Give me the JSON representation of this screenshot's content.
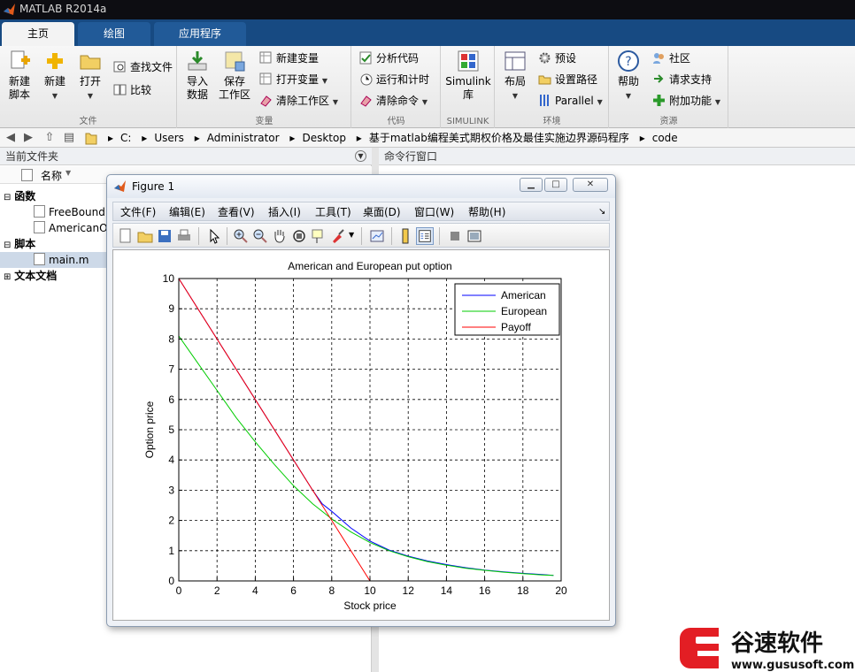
{
  "window": {
    "title": "MATLAB R2014a"
  },
  "tabs": [
    {
      "label": "主页"
    },
    {
      "label": "绘图"
    },
    {
      "label": "应用程序"
    }
  ],
  "ribbon": {
    "file": {
      "title": "文件",
      "new_script": "新建\n脚本",
      "new": "新建",
      "open": "打开",
      "find_files": "查找文件",
      "compare": "比较"
    },
    "variable": {
      "title": "变量",
      "import": "导入\n数据",
      "save_ws": "保存\n工作区",
      "new_var": "新建变量",
      "open_var": "打开变量",
      "clear_ws": "清除工作区"
    },
    "code": {
      "title": "代码",
      "analyze": "分析代码",
      "run_time": "运行和计时",
      "clear_cmd": "清除命令"
    },
    "simulink": {
      "title": "SIMULINK",
      "library": "Simulink\n库"
    },
    "env": {
      "title": "环境",
      "layout": "布局",
      "prefs": "预设",
      "set_path": "设置路径",
      "parallel": "Parallel"
    },
    "resources": {
      "title": "资源",
      "help": "帮助",
      "community": "社区",
      "support": "请求支持",
      "addons": "附加功能"
    }
  },
  "address": {
    "crumbs": [
      "C:",
      "Users",
      "Administrator",
      "Desktop",
      "基于matlab编程美式期权价格及最佳实施边界源码程序",
      "code"
    ]
  },
  "file_browser": {
    "title": "当前文件夹",
    "name_col": "名称",
    "rows": [
      {
        "label": "函数",
        "kind": "group"
      },
      {
        "label": "FreeBound",
        "kind": "file"
      },
      {
        "label": "AmericanO",
        "kind": "file"
      },
      {
        "label": "脚本",
        "kind": "group"
      },
      {
        "label": "main.m",
        "kind": "file"
      },
      {
        "label": "文本文档",
        "kind": "group"
      }
    ]
  },
  "command_window": {
    "title": "命令行窗口"
  },
  "figure": {
    "title": "Figure 1",
    "menus": [
      "文件(F)",
      "编辑(E)",
      "查看(V)",
      "插入(I)",
      "工具(T)",
      "桌面(D)",
      "窗口(W)",
      "帮助(H)"
    ]
  },
  "chart_data": {
    "type": "line",
    "title": "American and European put option",
    "xlabel": "Stock price",
    "ylabel": "Option price",
    "xlim": [
      0,
      20
    ],
    "ylim": [
      0,
      10
    ],
    "xticks": [
      0,
      2,
      4,
      6,
      8,
      10,
      12,
      14,
      16,
      18,
      20
    ],
    "yticks": [
      0,
      1,
      2,
      3,
      4,
      5,
      6,
      7,
      8,
      9,
      10
    ],
    "grid": true,
    "legend_position": "top-right",
    "series": [
      {
        "name": "American",
        "color": "#0000ff",
        "x": [
          0,
          2,
          4,
          6,
          7,
          7.5,
          8,
          9,
          10,
          11,
          12,
          13,
          14,
          15,
          16,
          17,
          18,
          19,
          19.6
        ],
        "y": [
          10,
          8,
          6,
          4,
          3,
          2.55,
          2.3,
          1.75,
          1.32,
          1.02,
          0.82,
          0.66,
          0.54,
          0.44,
          0.36,
          0.3,
          0.25,
          0.21,
          0.18
        ]
      },
      {
        "name": "European",
        "color": "#00cc00",
        "x": [
          0,
          1,
          2,
          3,
          4,
          5,
          6,
          7,
          8,
          9,
          10,
          11,
          12,
          13,
          14,
          15,
          16,
          17,
          18,
          19,
          19.6
        ],
        "y": [
          8.1,
          7.2,
          6.3,
          5.4,
          4.6,
          3.85,
          3.15,
          2.55,
          2.05,
          1.62,
          1.27,
          1.0,
          0.8,
          0.64,
          0.52,
          0.42,
          0.35,
          0.29,
          0.24,
          0.2,
          0.18
        ]
      },
      {
        "name": "Payoff",
        "color": "#ff0000",
        "x": [
          0,
          10,
          20
        ],
        "y": [
          10,
          0,
          0
        ]
      }
    ]
  },
  "watermark": {
    "brand": "谷速软件",
    "url": "www.gususoft.com"
  }
}
